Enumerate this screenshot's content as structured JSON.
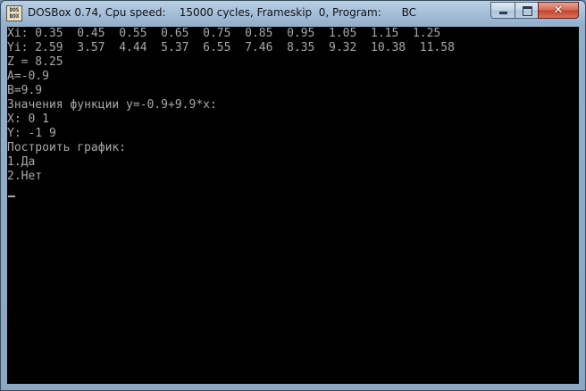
{
  "window": {
    "title": "DOSBox 0.74, Cpu speed:    15000 cycles, Frameskip  0, Program:      BC",
    "app_icon_text": "DOS BOX",
    "controls": {
      "minimize": "minimize",
      "maximize": "maximize",
      "close": "✕"
    }
  },
  "console": {
    "lines": [
      "Xi: 0.35  0.45  0.55  0.65  0.75  0.85  0.95  1.05  1.15  1.25",
      "Yi: 2.59  3.57  4.44  5.37  6.55  7.46  8.35  9.32  10.38  11.58",
      "Z = 8.25",
      "A=-0.9",
      "B=9.9",
      "Значения функции y=-0.9+9.9*x:",
      "X: 0 1",
      "Y: -1 9",
      "Построить график:",
      "1.Да",
      "2.Нет"
    ]
  },
  "colors": {
    "console_bg": "#000000",
    "console_text": "#a8a8a8",
    "close_button": "#c4432b"
  }
}
